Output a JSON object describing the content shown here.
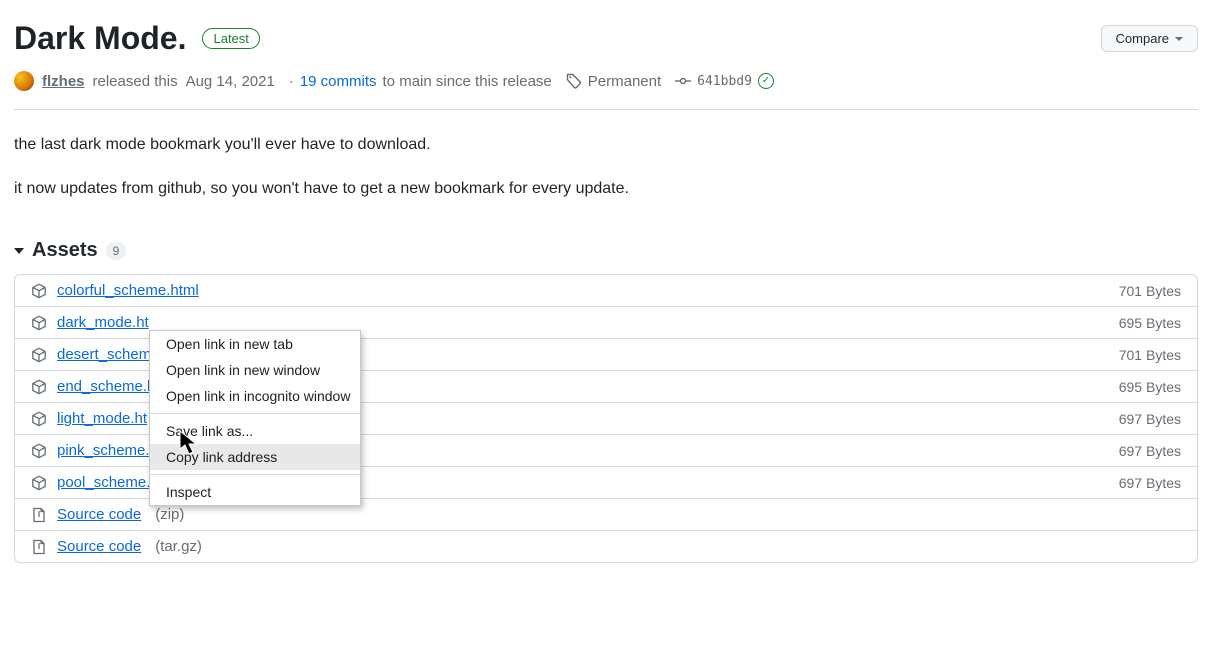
{
  "header": {
    "title": "Dark Mode.",
    "badge": "Latest",
    "compare_label": "Compare"
  },
  "meta": {
    "author": "flzhes",
    "released_text": "released this",
    "date": "Aug 14, 2021",
    "commits_count": "19 commits",
    "commits_suffix": "to main since this release",
    "tag_label": "Permanent",
    "commit_sha": "641bbd9"
  },
  "description": {
    "p1": "the last dark mode bookmark you'll ever have to download.",
    "p2": "it now updates from github, so you won't have to get a new bookmark for every update."
  },
  "assets": {
    "heading": "Assets",
    "count": "9",
    "items": [
      {
        "name": "colorful_scheme.html",
        "size": "701 Bytes",
        "icon": "package",
        "underline": true
      },
      {
        "name": "dark_mode.ht",
        "size": "695 Bytes",
        "icon": "package"
      },
      {
        "name": "desert_schem",
        "size": "701 Bytes",
        "icon": "package"
      },
      {
        "name": "end_scheme.h",
        "size": "695 Bytes",
        "icon": "package"
      },
      {
        "name": "light_mode.ht",
        "size": "697 Bytes",
        "icon": "package"
      },
      {
        "name": "pink_scheme.l",
        "size": "697 Bytes",
        "icon": "package"
      },
      {
        "name": "pool_scheme.html",
        "size": "697 Bytes",
        "icon": "package"
      },
      {
        "name": "Source code",
        "zip": "(zip)",
        "size": "",
        "icon": "zip"
      },
      {
        "name": "Source code",
        "zip": "(tar.gz)",
        "size": "",
        "icon": "zip"
      }
    ]
  },
  "context_menu": {
    "items": [
      "Open link in new tab",
      "Open link in new window",
      "Open link in incognito window",
      "Save link as...",
      "Copy link address",
      "Inspect"
    ],
    "highlight_index": 4
  }
}
